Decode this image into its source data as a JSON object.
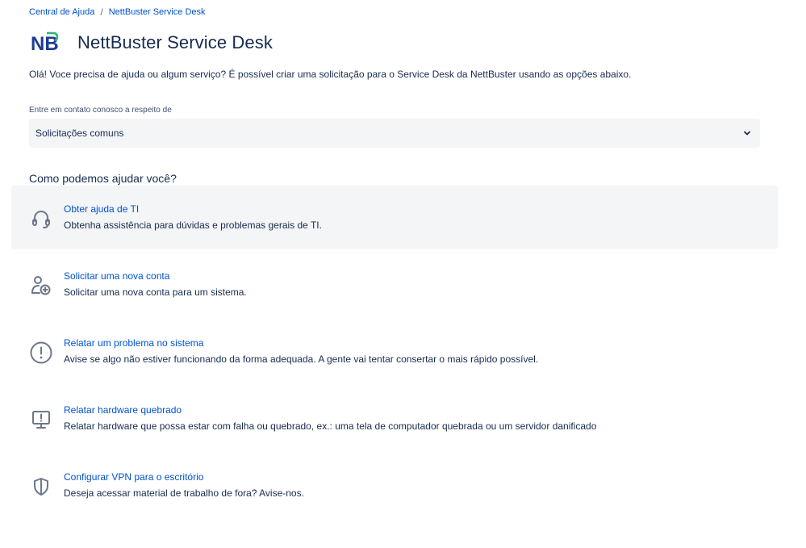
{
  "breadcrumb": {
    "home": "Central de Ajuda",
    "separator": "/",
    "current": "NettBuster Service Desk"
  },
  "header": {
    "logo_text": "NB",
    "title": "NettBuster Service Desk"
  },
  "intro": "Olá! Voce precisa de ajuda ou algum serviço? É possível criar uma solicitação para o Service Desk da NettBuster usando as opções abaixo.",
  "contact": {
    "label": "Entre em contato conosco a respeito de",
    "selected": "Solicitações comuns"
  },
  "help_heading": "Como podemos ajudar você?",
  "colors": {
    "link": "#0052cc",
    "text": "#172b4d",
    "muted": "#6b778c",
    "panel": "#f4f5f7",
    "logo_blue": "#1f3a93",
    "logo_green": "#2bb673"
  },
  "request_types": [
    {
      "title": "Obter ajuda de TI",
      "description": "Obtenha assistência para dúvidas e problemas gerais de TI.",
      "icon": "headset-icon"
    },
    {
      "title": "Solicitar uma nova conta",
      "description": "Solicitar uma nova conta para um sistema.",
      "icon": "add-user-icon"
    },
    {
      "title": "Relatar um problema no sistema",
      "description": "Avise se algo não estiver funcionando da forma adequada. A gente vai tentar consertar o mais rápido possível.",
      "icon": "alert-circle-icon"
    },
    {
      "title": "Relatar hardware quebrado",
      "description": "Relatar hardware que possa estar com falha ou quebrado, ex.: uma tela de computador quebrada ou um servidor danificado",
      "icon": "monitor-alert-icon"
    },
    {
      "title": "Configurar VPN para o escritório",
      "description": "Deseja acessar material de trabalho de fora? Avise-nos.",
      "icon": "shield-icon"
    }
  ]
}
